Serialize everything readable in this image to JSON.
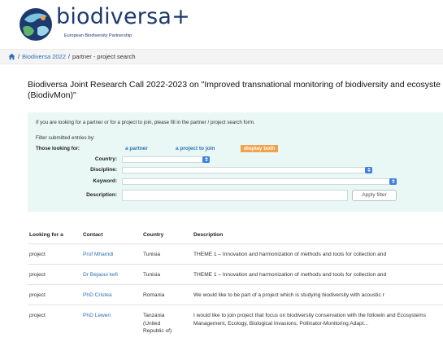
{
  "brand": {
    "name": "biodiversa+",
    "subtitle": "European Biodiversity Partnership",
    "logo_icon": "globe-logo-icon"
  },
  "breadcrumb": {
    "home_icon": "home-icon",
    "link": "Biodiversa 2022",
    "separator1": "/",
    "separator2": "/",
    "current": "partner - project search"
  },
  "page": {
    "title": "Biodiversa Joint Research Call 2022-2023 on \"Improved transnational monitoring of biodiversity and ecosyste\n(BiodivMon)\""
  },
  "filter": {
    "intro": "If you are looking for a partner or for a project to join, please fill in the partner / project search form.",
    "filter_label": "Filter submitted entries by:",
    "looking_label": "Those looking for:",
    "options": {
      "partner": "a partner",
      "project": "a project to join",
      "both": "display both"
    },
    "fields": {
      "country_label": "Country:",
      "discipline_label": "Discipline:",
      "keyword_label": "Keyword:",
      "description_label": "Description:"
    },
    "apply_label": "Apply filter",
    "colors": {
      "panel": "#e9f7f5",
      "active_option": "#f0a24a",
      "link": "#2e6fb5",
      "select_caret": "#3e7fe0"
    }
  },
  "table": {
    "headers": {
      "looking": "Looking for a",
      "contact": "Contact",
      "country": "Country",
      "description": "Description"
    },
    "rows": [
      {
        "looking": "project",
        "contact": "Prof Mhamdi",
        "country": "Tunisia",
        "description": "THEME 1 – Innovation and harmonization of methods and tools for collection and"
      },
      {
        "looking": "project",
        "contact": "Dr Bejaoui kefi",
        "country": "Tunisia",
        "description": "THEME 1 – Innovation and harmonization of methods and tools for collection and"
      },
      {
        "looking": "project",
        "contact": "PhD Cristea",
        "country": "Romania",
        "description": "We would like to be part of a project which is studying biodiversity with acoustic r"
      },
      {
        "looking": "project",
        "contact": "PhD Leweri",
        "country": "Tanzania (United Republic of)",
        "description": "I would like to join project that focus on biodiversity conservation with the followin and Ecosystems Management, Ecology, Biological Invasions, Pollinator-Monitoring Adapt..."
      }
    ]
  }
}
